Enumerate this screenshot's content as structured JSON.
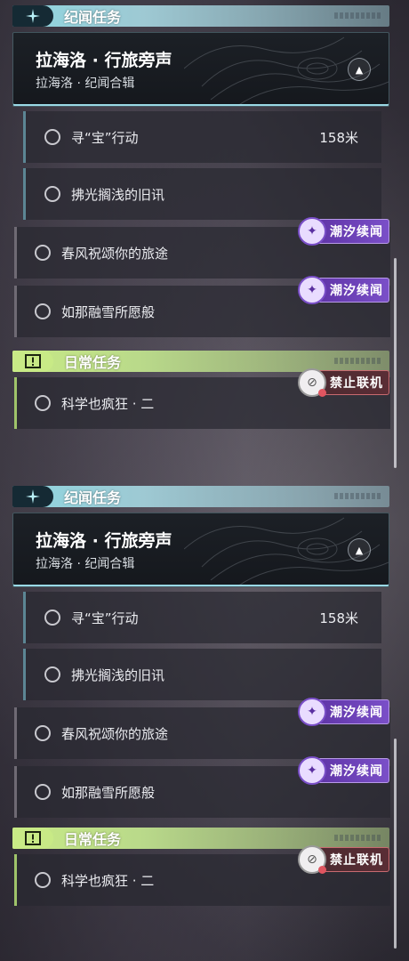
{
  "panels": [
    {
      "story_section": {
        "icon": "sparkle-icon",
        "title": "纪闻任务",
        "card": {
          "title": "拉海洛 · 行旅旁声",
          "subtitle": "拉海洛 · 纪闻合辑",
          "collapse_icon": "chevron-up-icon"
        },
        "quests": [
          {
            "label": "寻“宝”行动",
            "distance": "158米"
          },
          {
            "label": "拂光搁浅的旧讯"
          },
          {
            "label": "春风祝颂你的旅途",
            "tag": "潮汐续闻"
          },
          {
            "label": "如那融雪所愿般",
            "tag": "潮汐续闻"
          }
        ]
      },
      "daily_section": {
        "icon": "exclamation-icon",
        "title": "日常任务",
        "quests": [
          {
            "label": "科学也疯狂 · 二",
            "tag": "禁止联机"
          }
        ]
      }
    },
    {
      "story_section": {
        "icon": "sparkle-icon",
        "title": "纪闻任务",
        "card": {
          "title": "拉海洛 · 行旅旁声",
          "subtitle": "拉海洛 · 纪闻合辑",
          "collapse_icon": "chevron-up-icon"
        },
        "quests": [
          {
            "label": "寻“宝”行动",
            "distance": "158米"
          },
          {
            "label": "拂光搁浅的旧讯"
          },
          {
            "label": "春风祝颂你的旅途",
            "tag": "潮汐续闻"
          },
          {
            "label": "如那融雪所愿般",
            "tag": "潮汐续闻"
          }
        ]
      },
      "daily_section": {
        "icon": "exclamation-icon",
        "title": "日常任务",
        "quests": [
          {
            "label": "科学也疯狂 · 二",
            "tag": "禁止联机"
          }
        ]
      }
    }
  ],
  "colors": {
    "story_accent": "#8fd6e0",
    "daily_accent": "#c8ea86",
    "tag_purple": "#6a3fb8",
    "tag_red": "#c86a70"
  }
}
